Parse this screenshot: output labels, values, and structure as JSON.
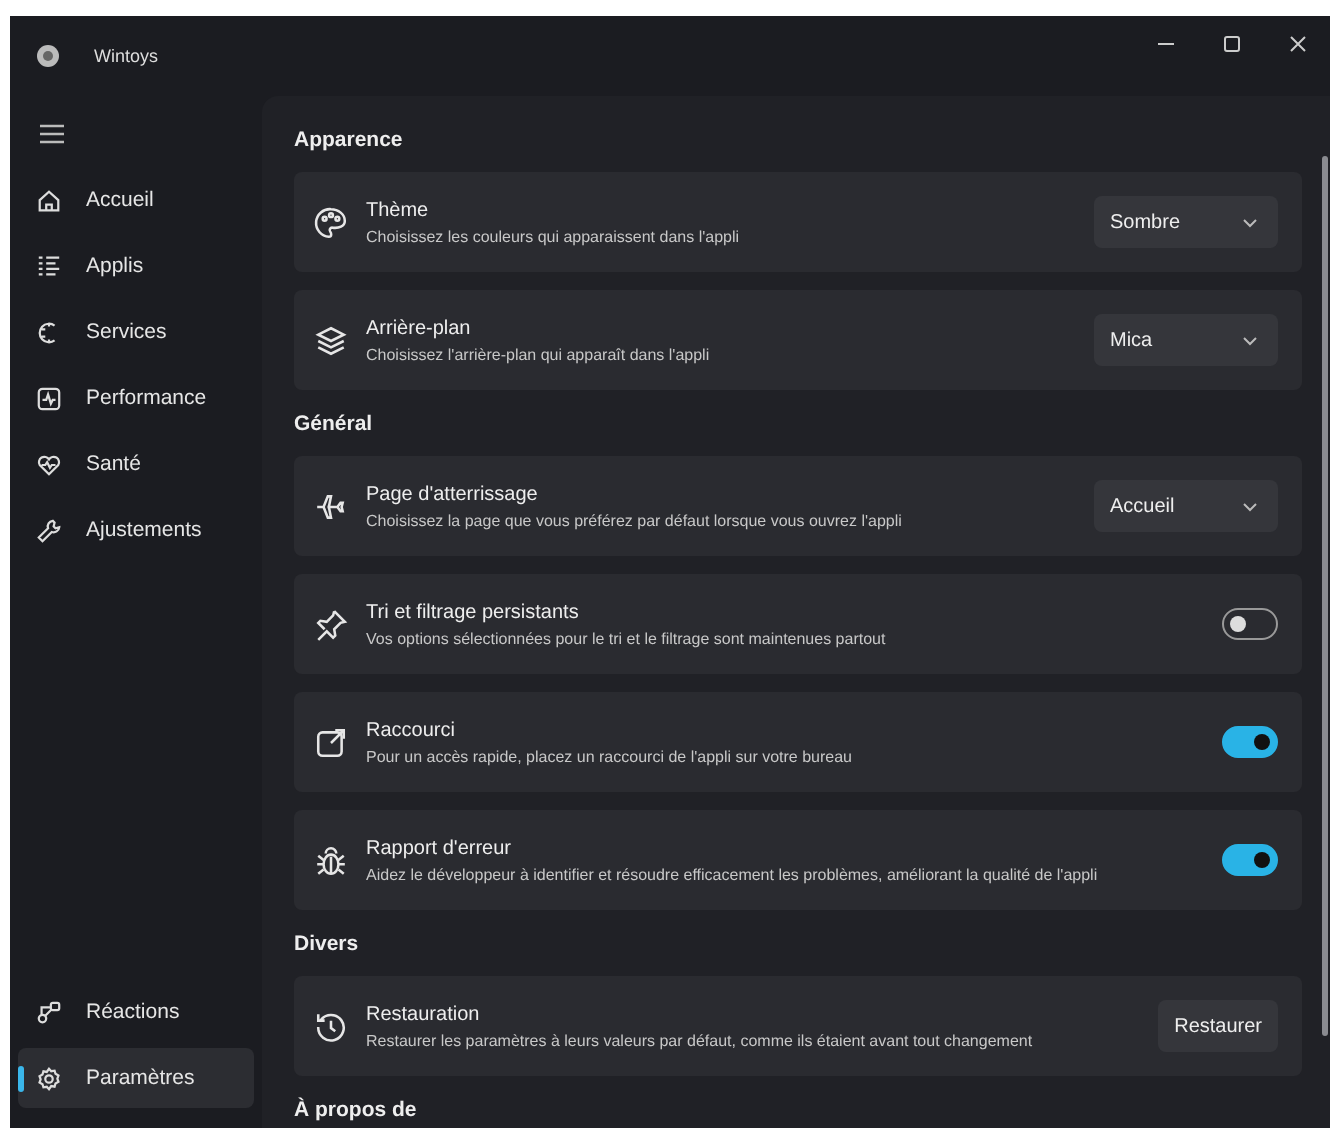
{
  "window": {
    "title": "Wintoys"
  },
  "sidebar": {
    "items": [
      {
        "label": "Accueil",
        "selected": false
      },
      {
        "label": "Applis",
        "selected": false
      },
      {
        "label": "Services",
        "selected": false
      },
      {
        "label": "Performance",
        "selected": false
      },
      {
        "label": "Santé",
        "selected": false
      },
      {
        "label": "Ajustements",
        "selected": false
      }
    ],
    "footer_items": [
      {
        "label": "Réactions",
        "selected": false
      },
      {
        "label": "Paramètres",
        "selected": true
      }
    ]
  },
  "sections": [
    {
      "heading": "Apparence",
      "settings": [
        {
          "kind": "dropdown",
          "title": "Thème",
          "description": "Choisissez les couleurs qui apparaissent dans l'appli",
          "value": "Sombre"
        },
        {
          "kind": "dropdown",
          "title": "Arrière-plan",
          "description": "Choisissez l'arrière-plan qui apparaît dans l'appli",
          "value": "Mica"
        }
      ]
    },
    {
      "heading": "Général",
      "settings": [
        {
          "kind": "dropdown",
          "title": "Page d'atterrissage",
          "description": "Choisissez la page que vous préférez par défaut lorsque vous ouvrez l'appli",
          "value": "Accueil"
        },
        {
          "kind": "toggle",
          "title": "Tri et filtrage persistants",
          "description": "Vos options sélectionnées pour le tri et le filtrage sont maintenues partout",
          "on": false
        },
        {
          "kind": "toggle",
          "title": "Raccourci",
          "description": "Pour un accès rapide, placez un raccourci de l'appli sur votre bureau",
          "on": true
        },
        {
          "kind": "toggle",
          "title": "Rapport d'erreur",
          "description": "Aidez le développeur à identifier et résoudre efficacement les problèmes, améliorant la qualité de l'appli",
          "on": true
        }
      ]
    },
    {
      "heading": "Divers",
      "settings": [
        {
          "kind": "button",
          "title": "Restauration",
          "description": "Restaurer les paramètres à leurs valeurs par défaut, comme ils étaient avant tout changement",
          "button": "Restaurer"
        }
      ]
    },
    {
      "heading": "À propos de"
    }
  ]
}
